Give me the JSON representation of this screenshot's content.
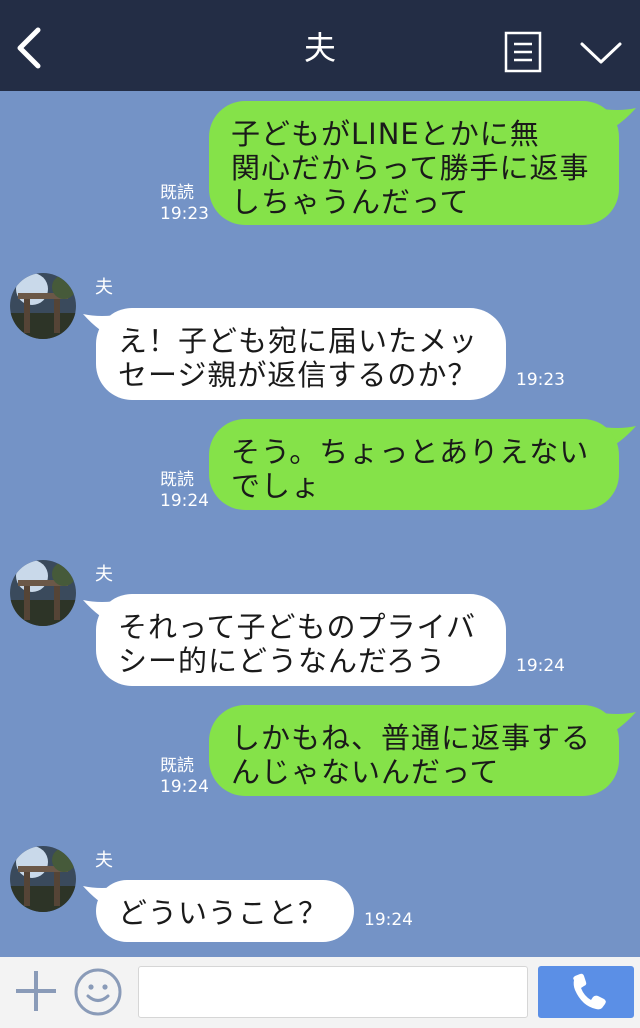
{
  "header": {
    "title": "夫"
  },
  "messages": [
    {
      "side": "sent",
      "text": "子どもがLINEとかに無\n関心だからって勝手に返事\nしちゃうんだって",
      "read": "既読",
      "time": "19:23"
    },
    {
      "side": "recv",
      "sender": "夫",
      "text": "え！子ども宛に届いたメッ\nセージ親が返信するのか？",
      "time": "19:23"
    },
    {
      "side": "sent",
      "text": "そう。ちょっとありえない\nでしょ",
      "read": "既読",
      "time": "19:24"
    },
    {
      "side": "recv",
      "sender": "夫",
      "text": "それって子どものプライバ\nシー的にどうなんだろう",
      "time": "19:24"
    },
    {
      "side": "sent",
      "text": "しかもね、普通に返事する\nんじゃないんだって",
      "read": "既読",
      "time": "19:24"
    },
    {
      "side": "recv",
      "sender": "夫",
      "text": "どういうこと？",
      "time": "19:24"
    }
  ],
  "footer": {
    "input_value": "",
    "input_placeholder": ""
  },
  "icons": {
    "back": "chevron-left-icon",
    "menu": "menu-icon",
    "collapse": "chevron-down-icon",
    "add": "plus-icon",
    "emoji": "smiley-icon",
    "call": "phone-icon"
  },
  "colors": {
    "header_bg": "#232d45",
    "chat_bg": "#7493c6",
    "sent_bubble": "#85e249",
    "recv_bubble": "#ffffff",
    "call_button": "#5b8fe6"
  }
}
